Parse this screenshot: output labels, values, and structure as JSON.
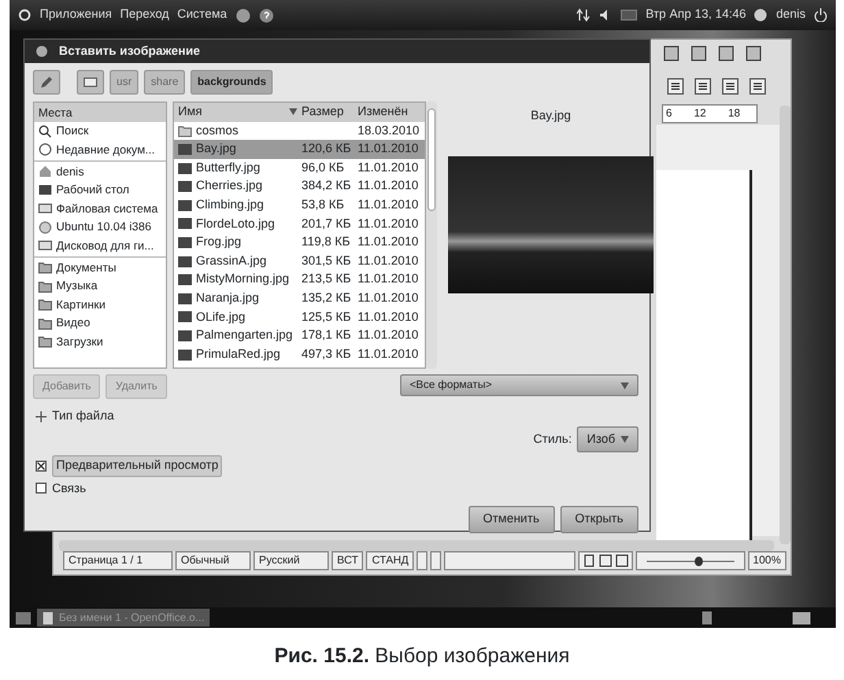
{
  "top_panel": {
    "menus": [
      "Приложения",
      "Переход",
      "Система"
    ],
    "clock": "Втр Апр 13, 14:46",
    "user": "denis"
  },
  "writer": {
    "ruler_marks": [
      "6",
      "12",
      "18"
    ],
    "status_cells": [
      "Страница  1 / 1",
      "Обычный",
      "Русский",
      "ВСТ",
      "СТАНД"
    ],
    "zoom_slider": {
      "level": 0.55
    },
    "zoom": "100%"
  },
  "dialog": {
    "title": "Вставить изображение",
    "path_buttons": [
      {
        "label": "usr",
        "selected": false
      },
      {
        "label": "share",
        "selected": false
      },
      {
        "label": "backgrounds",
        "selected": true
      }
    ],
    "places": {
      "header": "Места",
      "sections": [
        [
          {
            "label": "Поиск",
            "kind": "search"
          },
          {
            "label": "Недавние докум...",
            "kind": "recent"
          }
        ],
        [
          {
            "label": "denis",
            "kind": "home"
          },
          {
            "label": "Рабочий стол",
            "kind": "desktop"
          },
          {
            "label": "Файловая система",
            "kind": "drive"
          },
          {
            "label": "Ubuntu 10.04 i386",
            "kind": "disc"
          },
          {
            "label": "Дисковод для ги...",
            "kind": "drive"
          }
        ],
        [
          {
            "label": "Документы",
            "kind": "folder"
          },
          {
            "label": "Музыка",
            "kind": "folder"
          },
          {
            "label": "Картинки",
            "kind": "folder"
          },
          {
            "label": "Видео",
            "kind": "folder"
          },
          {
            "label": "Загрузки",
            "kind": "folder"
          }
        ]
      ]
    },
    "place_buttons": [
      {
        "label": "Добавить",
        "disabled": true
      },
      {
        "label": "Удалить",
        "disabled": true
      }
    ],
    "columns": [
      "Имя",
      "Размер",
      "Изменён"
    ],
    "files": [
      {
        "name": "cosmos",
        "modified": "18.03.2010",
        "kind": "folder",
        "selected": false
      },
      {
        "name": "Bay.jpg",
        "size": "120,6 КБ",
        "modified": "11.01.2010",
        "kind": "image",
        "selected": true
      },
      {
        "name": "Butterfly.jpg",
        "size": "96,0 КБ",
        "modified": "11.01.2010",
        "kind": "image",
        "selected": false
      },
      {
        "name": "Cherries.jpg",
        "size": "384,2 КБ",
        "modified": "11.01.2010",
        "kind": "image",
        "selected": false
      },
      {
        "name": "Climbing.jpg",
        "size": "53,8 КБ",
        "modified": "11.01.2010",
        "kind": "image",
        "selected": false
      },
      {
        "name": "FlordeLoto.jpg",
        "size": "201,7 КБ",
        "modified": "11.01.2010",
        "kind": "image",
        "selected": false
      },
      {
        "name": "Frog.jpg",
        "size": "119,8 КБ",
        "modified": "11.01.2010",
        "kind": "image",
        "selected": false
      },
      {
        "name": "GrassinA.jpg",
        "size": "301,5 КБ",
        "modified": "11.01.2010",
        "kind": "image",
        "selected": false
      },
      {
        "name": "MistyMorning.jpg",
        "size": "213,5 КБ",
        "modified": "11.01.2010",
        "kind": "image",
        "selected": false
      },
      {
        "name": "Naranja.jpg",
        "size": "135,2 КБ",
        "modified": "11.01.2010",
        "kind": "image",
        "selected": false
      },
      {
        "name": "OLife.jpg",
        "size": "125,5 КБ",
        "modified": "11.01.2010",
        "kind": "image",
        "selected": false
      },
      {
        "name": "Palmengarten.jpg",
        "size": "178,1 КБ",
        "modified": "11.01.2010",
        "kind": "image",
        "selected": false
      },
      {
        "name": "PrimulaRed.jpg",
        "size": "497,3 КБ",
        "modified": "11.01.2010",
        "kind": "image",
        "selected": false
      }
    ],
    "preview_title": "Bay.jpg",
    "filter": "<Все форматы>",
    "expander": {
      "label": "Тип файла",
      "expanded": false
    },
    "style_label": "Стиль:",
    "style_value": "Изоб",
    "checkboxes": [
      {
        "label": "Предварительный просмотр",
        "checked": true
      },
      {
        "label": "Связь",
        "checked": false
      }
    ],
    "buttons": [
      "Отменить",
      "Открыть"
    ]
  },
  "taskbar": {
    "task": "Без имени 1 - OpenOffice.o..."
  },
  "caption": "**Рис. 15.2.** Выбор изображения"
}
